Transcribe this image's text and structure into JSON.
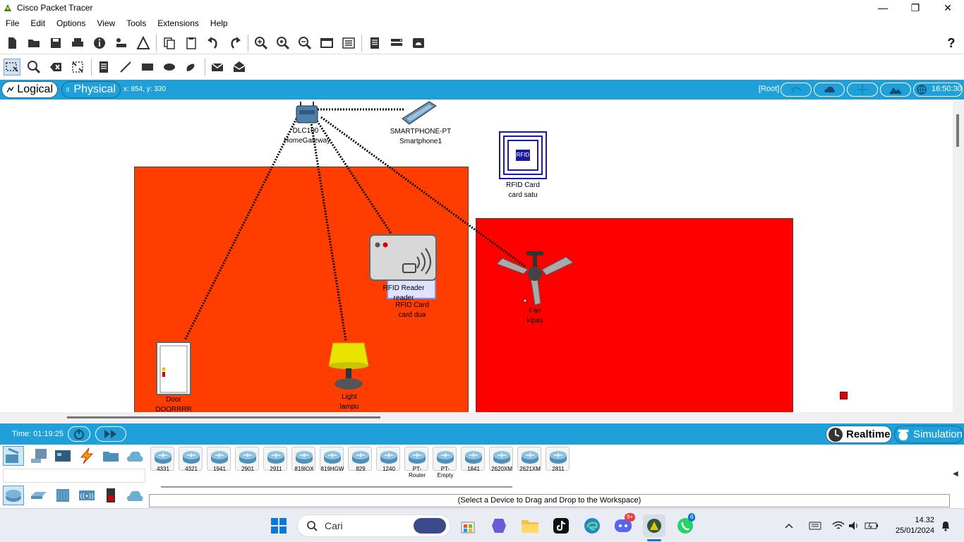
{
  "window": {
    "title": "Cisco Packet Tracer"
  },
  "menu": [
    "File",
    "Edit",
    "Options",
    "View",
    "Tools",
    "Extensions",
    "Help"
  ],
  "toolbar": {
    "main_icons": [
      "new-file-icon",
      "open-folder-icon",
      "save-icon",
      "print-icon",
      "info-icon",
      "network-wizard-icon",
      "activity-wizard-icon",
      "copy-icon",
      "paste-icon",
      "undo-icon",
      "redo-icon",
      "zoom-in-icon",
      "zoom-reset-icon",
      "zoom-out-icon",
      "drawing-palette-icon",
      "custom-devices-icon",
      "ipc-icon",
      "viewport-icon",
      "cloud-icon",
      "help-icon"
    ],
    "tool_icons": [
      "select-icon",
      "inspect-icon",
      "delete-icon",
      "resize-icon",
      "note-icon",
      "line-icon",
      "rectangle-icon",
      "ellipse-icon",
      "freeform-icon",
      "add-simple-pdu-icon",
      "add-complex-pdu-icon"
    ]
  },
  "mode_bar": {
    "logical": "Logical",
    "physical": "Physical",
    "coords": "x: 854, y: 330",
    "root": "[Root]",
    "clock": "16:50:30"
  },
  "workspace": {
    "devices": {
      "gateway": {
        "model": "DLC100",
        "name": "HomeGateway"
      },
      "smartphone": {
        "model": "SMARTPHONE-PT",
        "name": "Smartphone1"
      },
      "rfid_card_1": {
        "model": "RFID Card",
        "name": "card satu",
        "chip_label": "RFID"
      },
      "rfid_reader": {
        "model": "RFID Reader",
        "name": "reader"
      },
      "rfid_card_2": {
        "model": "RFID Card",
        "name": "card dua"
      },
      "fan": {
        "model": "Fan",
        "name": "kipas"
      },
      "door": {
        "model": "Door",
        "name": "DOORRRR"
      },
      "light": {
        "model": "Light",
        "name": "lampu"
      }
    },
    "colors": {
      "room_left": "#ff3d00",
      "room_right": "#ff0000",
      "marker": "#e00000"
    }
  },
  "bottom_bar": {
    "time": "Time: 01:19:25",
    "realtime": "Realtime",
    "simulation": "Simulation"
  },
  "palette": {
    "devices": [
      "4331",
      "4321",
      "1941",
      "2901",
      "2911",
      "819IOX",
      "819HGW",
      "829",
      "1240",
      "PT-Router",
      "PT-Empty",
      "1841",
      "2620XM",
      "2621XM",
      "2811"
    ],
    "status": "(Select a Device to Drag and Drop to the Workspace)"
  },
  "taskbar": {
    "search": "Cari",
    "time": "14.32",
    "date": "25/01/2024",
    "discord_badge": "9+",
    "whatsapp_badge": "6"
  }
}
